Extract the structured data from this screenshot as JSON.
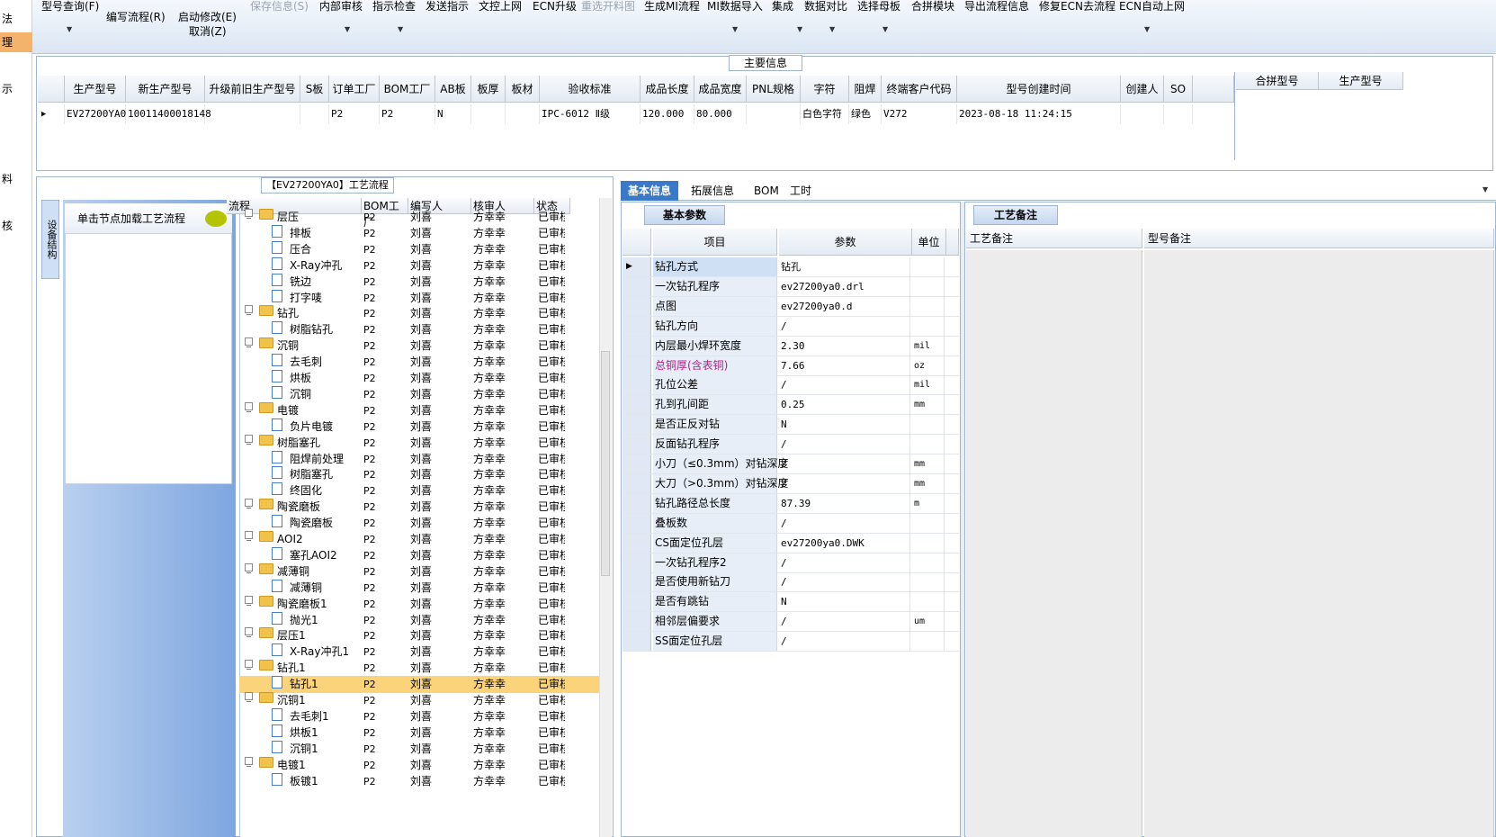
{
  "left_strip": {
    "items": [
      "法",
      "理",
      "示",
      "料",
      "核"
    ],
    "selected_index": 1
  },
  "toolbar": {
    "items": [
      {
        "label": "型号查询(F)",
        "disabled": false
      },
      {
        "label": "编写流程(R)",
        "disabled": false
      },
      {
        "label": "启动修改(E)",
        "sub": "取消(Z)",
        "disabled": false
      },
      {
        "label": "保存信息(S)",
        "disabled": true
      },
      {
        "label": "内部审核",
        "disabled": false
      },
      {
        "label": "指示检查",
        "disabled": false
      },
      {
        "label": "发送指示",
        "disabled": false
      },
      {
        "label": "文控上网",
        "disabled": false
      },
      {
        "label": "ECN升级",
        "disabled": false
      },
      {
        "label": "重选开料图",
        "disabled": true
      },
      {
        "label": "生成MI流程",
        "disabled": false
      },
      {
        "label": "MI数据导入",
        "disabled": false
      },
      {
        "label": "集成",
        "disabled": false
      },
      {
        "label": "数据对比",
        "disabled": false
      },
      {
        "label": "选择母板",
        "disabled": false
      },
      {
        "label": "合拼模块",
        "disabled": false
      },
      {
        "label": "导出流程信息",
        "disabled": false
      },
      {
        "label": "修复ECN去流程",
        "disabled": false
      },
      {
        "label": "ECN自动上网",
        "disabled": false
      }
    ]
  },
  "main_info": {
    "title": "主要信息",
    "columns": [
      "生产型号",
      "新生产型号",
      "升级前旧生产型号",
      "S板",
      "订单工厂",
      "BOM工厂",
      "AB板",
      "板厚",
      "板材",
      "验收标准",
      "成品长度",
      "成品宽度",
      "PNL规格",
      "字符",
      "阻焊",
      "终端客户代码",
      "型号创建时间",
      "创建人",
      "SO"
    ],
    "row": [
      "EV27200YA0",
      "10011400018148",
      "",
      "",
      "P2",
      "P2",
      "N",
      "",
      "",
      "IPC-6012 Ⅱ级",
      "120.000",
      "80.000",
      "",
      "白色字符",
      "绿色",
      "V272",
      "2023-08-18 11:24:15",
      "",
      ""
    ],
    "side_columns": [
      "合拼型号",
      "生产型号"
    ]
  },
  "node_panel": {
    "side_tab": "设备结构",
    "header": "单击节点加载工艺流程"
  },
  "flow": {
    "title": "【EV27200YA0】工艺流程",
    "columns": [
      "流程",
      "BOM工厂",
      "编写人",
      "核审人",
      "状态"
    ],
    "rows": [
      {
        "level": 0,
        "name": "层压",
        "bom": "P2",
        "writer": "刘喜",
        "reviewer": "方幸幸",
        "status": "已审核"
      },
      {
        "level": 1,
        "name": "排板",
        "bom": "P2",
        "writer": "刘喜",
        "reviewer": "方幸幸",
        "status": "已审核"
      },
      {
        "level": 1,
        "name": "压合",
        "bom": "P2",
        "writer": "刘喜",
        "reviewer": "方幸幸",
        "status": "已审核"
      },
      {
        "level": 1,
        "name": "X-Ray冲孔",
        "bom": "P2",
        "writer": "刘喜",
        "reviewer": "方幸幸",
        "status": "已审核"
      },
      {
        "level": 1,
        "name": "铣边",
        "bom": "P2",
        "writer": "刘喜",
        "reviewer": "方幸幸",
        "status": "已审核"
      },
      {
        "level": 1,
        "name": "打字唛",
        "bom": "P2",
        "writer": "刘喜",
        "reviewer": "方幸幸",
        "status": "已审核"
      },
      {
        "level": 0,
        "name": "钻孔",
        "bom": "P2",
        "writer": "刘喜",
        "reviewer": "方幸幸",
        "status": "已审核"
      },
      {
        "level": 1,
        "name": "树脂钻孔",
        "bom": "P2",
        "writer": "刘喜",
        "reviewer": "方幸幸",
        "status": "已审核"
      },
      {
        "level": 0,
        "name": "沉铜",
        "bom": "P2",
        "writer": "刘喜",
        "reviewer": "方幸幸",
        "status": "已审核"
      },
      {
        "level": 1,
        "name": "去毛刺",
        "bom": "P2",
        "writer": "刘喜",
        "reviewer": "方幸幸",
        "status": "已审核"
      },
      {
        "level": 1,
        "name": "烘板",
        "bom": "P2",
        "writer": "刘喜",
        "reviewer": "方幸幸",
        "status": "已审核"
      },
      {
        "level": 1,
        "name": "沉铜",
        "bom": "P2",
        "writer": "刘喜",
        "reviewer": "方幸幸",
        "status": "已审核"
      },
      {
        "level": 0,
        "name": "电镀",
        "bom": "P2",
        "writer": "刘喜",
        "reviewer": "方幸幸",
        "status": "已审核"
      },
      {
        "level": 1,
        "name": "负片电镀",
        "bom": "P2",
        "writer": "刘喜",
        "reviewer": "方幸幸",
        "status": "已审核"
      },
      {
        "level": 0,
        "name": "树脂塞孔",
        "bom": "P2",
        "writer": "刘喜",
        "reviewer": "方幸幸",
        "status": "已审核"
      },
      {
        "level": 1,
        "name": "阻焊前处理",
        "bom": "P2",
        "writer": "刘喜",
        "reviewer": "方幸幸",
        "status": "已审核"
      },
      {
        "level": 1,
        "name": "树脂塞孔",
        "bom": "P2",
        "writer": "刘喜",
        "reviewer": "方幸幸",
        "status": "已审核"
      },
      {
        "level": 1,
        "name": "终固化",
        "bom": "P2",
        "writer": "刘喜",
        "reviewer": "方幸幸",
        "status": "已审核"
      },
      {
        "level": 0,
        "name": "陶瓷磨板",
        "bom": "P2",
        "writer": "刘喜",
        "reviewer": "方幸幸",
        "status": "已审核"
      },
      {
        "level": 1,
        "name": "陶瓷磨板",
        "bom": "P2",
        "writer": "刘喜",
        "reviewer": "方幸幸",
        "status": "已审核"
      },
      {
        "level": 0,
        "name": "AOI2",
        "bom": "P2",
        "writer": "刘喜",
        "reviewer": "方幸幸",
        "status": "已审核"
      },
      {
        "level": 1,
        "name": "塞孔AOI2",
        "bom": "P2",
        "writer": "刘喜",
        "reviewer": "方幸幸",
        "status": "已审核"
      },
      {
        "level": 0,
        "name": "减薄铜",
        "bom": "P2",
        "writer": "刘喜",
        "reviewer": "方幸幸",
        "status": "已审核"
      },
      {
        "level": 1,
        "name": "减薄铜",
        "bom": "P2",
        "writer": "刘喜",
        "reviewer": "方幸幸",
        "status": "已审核"
      },
      {
        "level": 0,
        "name": "陶瓷磨板1",
        "bom": "P2",
        "writer": "刘喜",
        "reviewer": "方幸幸",
        "status": "已审核"
      },
      {
        "level": 1,
        "name": "抛光1",
        "bom": "P2",
        "writer": "刘喜",
        "reviewer": "方幸幸",
        "status": "已审核"
      },
      {
        "level": 0,
        "name": "层压1",
        "bom": "P2",
        "writer": "刘喜",
        "reviewer": "方幸幸",
        "status": "已审核"
      },
      {
        "level": 1,
        "name": "X-Ray冲孔1",
        "bom": "P2",
        "writer": "刘喜",
        "reviewer": "方幸幸",
        "status": "已审核"
      },
      {
        "level": 0,
        "name": "钻孔1",
        "bom": "P2",
        "writer": "刘喜",
        "reviewer": "方幸幸",
        "status": "已审核"
      },
      {
        "level": 1,
        "name": "钻孔1",
        "bom": "P2",
        "writer": "刘喜",
        "reviewer": "方幸幸",
        "status": "已审核",
        "selected": true
      },
      {
        "level": 0,
        "name": "沉铜1",
        "bom": "P2",
        "writer": "刘喜",
        "reviewer": "方幸幸",
        "status": "已审核"
      },
      {
        "level": 1,
        "name": "去毛刺1",
        "bom": "P2",
        "writer": "刘喜",
        "reviewer": "方幸幸",
        "status": "已审核"
      },
      {
        "level": 1,
        "name": "烘板1",
        "bom": "P2",
        "writer": "刘喜",
        "reviewer": "方幸幸",
        "status": "已审核"
      },
      {
        "level": 1,
        "name": "沉铜1",
        "bom": "P2",
        "writer": "刘喜",
        "reviewer": "方幸幸",
        "status": "已审核"
      },
      {
        "level": 0,
        "name": "电镀1",
        "bom": "P2",
        "writer": "刘喜",
        "reviewer": "方幸幸",
        "status": "已审核"
      },
      {
        "level": 1,
        "name": "板镀1",
        "bom": "P2",
        "writer": "刘喜",
        "reviewer": "方幸幸",
        "status": "已审核"
      }
    ]
  },
  "tabs": [
    "基本信息",
    "拓展信息",
    "BOM",
    "工时"
  ],
  "basic": {
    "title": "基本参数",
    "columns": [
      "项目",
      "参数",
      "单位"
    ],
    "rows": [
      {
        "item": "钻孔方式",
        "param": "钻孔",
        "unit": "",
        "current": true
      },
      {
        "item": "一次钻孔程序",
        "param": "ev27200ya0.drl",
        "unit": ""
      },
      {
        "item": "点图",
        "param": "ev27200ya0.d",
        "unit": ""
      },
      {
        "item": "钻孔方向",
        "param": "/",
        "unit": ""
      },
      {
        "item": "内层最小焊环宽度",
        "param": "2.30",
        "unit": "mil"
      },
      {
        "item": "总铜厚(含表铜)",
        "param": "7.66",
        "unit": "oz",
        "highlight": true
      },
      {
        "item": "孔位公差",
        "param": "/",
        "unit": "mil"
      },
      {
        "item": "孔到孔间距",
        "param": "0.25",
        "unit": "mm"
      },
      {
        "item": "是否正反对钻",
        "param": "N",
        "unit": ""
      },
      {
        "item": "反面钻孔程序",
        "param": "/",
        "unit": ""
      },
      {
        "item": "小刀（≤0.3mm）对钻深度",
        "param": "/",
        "unit": "mm"
      },
      {
        "item": "大刀（>0.3mm）对钻深度",
        "param": "/",
        "unit": "mm"
      },
      {
        "item": "钻孔路径总长度",
        "param": "87.39",
        "unit": "m"
      },
      {
        "item": "叠板数",
        "param": "/",
        "unit": ""
      },
      {
        "item": "CS面定位孔层",
        "param": "ev27200ya0.DWK",
        "unit": ""
      },
      {
        "item": "一次钻孔程序2",
        "param": "/",
        "unit": ""
      },
      {
        "item": "是否使用新钻刀",
        "param": "/",
        "unit": ""
      },
      {
        "item": "是否有跳钻",
        "param": "N",
        "unit": ""
      },
      {
        "item": "相邻层偏要求",
        "param": "/",
        "unit": "um"
      },
      {
        "item": "SS面定位孔层",
        "param": "/",
        "unit": ""
      }
    ]
  },
  "notes": {
    "title": "工艺备注",
    "columns": [
      "工艺备注",
      "型号备注"
    ]
  },
  "colors": {
    "accent": "#3a78c8",
    "selected_row": "#fbd37a",
    "highlight_text": "#b0208a"
  }
}
